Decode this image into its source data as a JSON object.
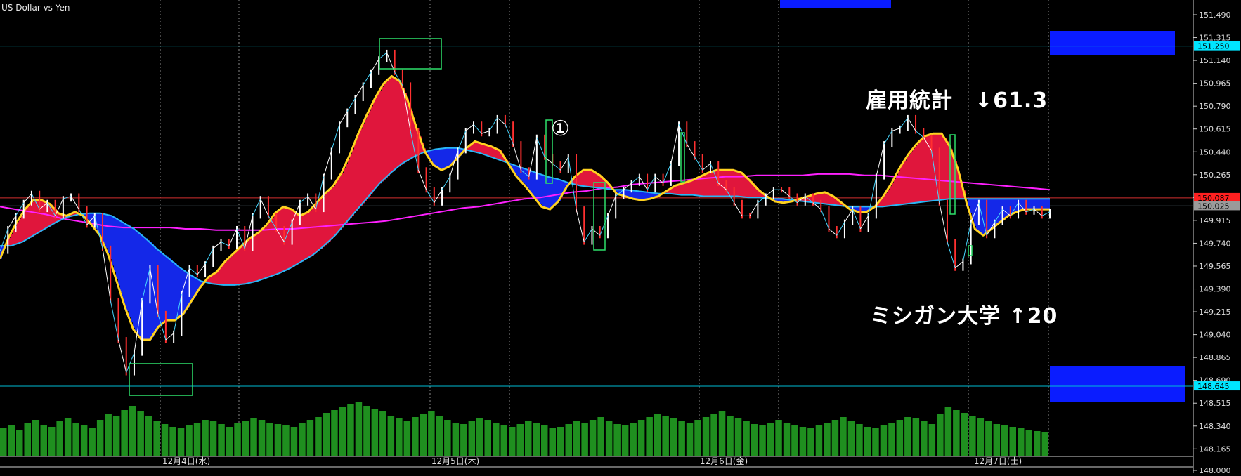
{
  "chart_data": {
    "type": "line",
    "symbol_title": "US Dollar vs Yen",
    "y_ticks": [
      "151.490",
      "151.315",
      "151.140",
      "150.965",
      "150.790",
      "150.615",
      "150.440",
      "150.265",
      "150.090",
      "149.915",
      "149.740",
      "149.565",
      "149.390",
      "149.215",
      "149.040",
      "148.865",
      "148.690",
      "148.515",
      "148.340",
      "148.165",
      "148.000"
    ],
    "y_range": [
      148.0,
      151.49
    ],
    "x_labels": [
      "12月4日(水)",
      "12月5日(木)",
      "12月6日(金)",
      "12月7日(土)"
    ],
    "price_labels": [
      {
        "value": 151.25,
        "text": "151.250",
        "color": "#00e5ff"
      },
      {
        "value": 150.087,
        "text": "150.087",
        "color": "#ff2020"
      },
      {
        "value": 150.025,
        "text": "150.025",
        "color": "#9a9a9a"
      },
      {
        "value": 148.645,
        "text": "148.645",
        "color": "#00e5ff"
      }
    ],
    "horizontal_lines": [
      151.25,
      150.087,
      150.025,
      148.645
    ],
    "series": [
      {
        "color": "#ffffff",
        "values": [
          149.68,
          149.85,
          149.95,
          150.05,
          150.12,
          150.0,
          150.05,
          149.95,
          150.08,
          150.1,
          150.0,
          149.88,
          149.95,
          149.7,
          149.3,
          149.0,
          148.75,
          148.9,
          149.3,
          149.55,
          149.2,
          149.0,
          149.05,
          149.35,
          149.55,
          149.5,
          149.58,
          149.7,
          149.75,
          149.72,
          149.85,
          149.7,
          149.95,
          150.08,
          149.95,
          149.85,
          149.75,
          149.9,
          150.05,
          150.1,
          150.0,
          150.25,
          150.45,
          150.65,
          150.75,
          150.85,
          150.95,
          151.05,
          151.15,
          151.2,
          151.05,
          150.95,
          150.6,
          150.3,
          150.15,
          150.05,
          150.15,
          150.25,
          150.45,
          150.6,
          150.65,
          150.58,
          150.6,
          150.7,
          150.65,
          150.5,
          150.3,
          150.25,
          150.55,
          150.4,
          150.35,
          150.3,
          150.4,
          150.0,
          149.75,
          149.85,
          149.8,
          149.95,
          150.1,
          150.15,
          150.2,
          150.25,
          150.15,
          150.25,
          150.2,
          150.35,
          150.65,
          150.5,
          150.4,
          150.3,
          150.35,
          150.2,
          150.15,
          150.05,
          149.95,
          149.95,
          150.05,
          150.1,
          150.15,
          150.15,
          150.1,
          150.05,
          150.1,
          150.05,
          150.0,
          149.85,
          149.8,
          149.9,
          150.0,
          149.85,
          149.95,
          150.25,
          150.5,
          150.6,
          150.62,
          150.7,
          150.6,
          150.55,
          150.45,
          150.05,
          149.75,
          149.55,
          149.6,
          149.9,
          150.05,
          149.8,
          149.9,
          150.0,
          149.95,
          150.05,
          149.98,
          150.0,
          149.95,
          149.98
        ]
      },
      {
        "color": "#ffd21f",
        "values": [
          149.62,
          149.78,
          149.9,
          150.0,
          150.07,
          150.07,
          150.04,
          149.97,
          149.95,
          149.98,
          149.95,
          149.88,
          149.8,
          149.65,
          149.45,
          149.25,
          149.08,
          149.0,
          149.0,
          149.1,
          149.15,
          149.15,
          149.2,
          149.3,
          149.4,
          149.48,
          149.52,
          149.6,
          149.66,
          149.72,
          149.78,
          149.82,
          149.88,
          149.97,
          150.02,
          150.0,
          149.95,
          149.98,
          150.05,
          150.12,
          150.18,
          150.28,
          150.42,
          150.58,
          150.72,
          150.85,
          150.96,
          151.02,
          150.98,
          150.82,
          150.62,
          150.44,
          150.34,
          150.3,
          150.33,
          150.4,
          150.47,
          150.52,
          150.5,
          150.48,
          150.45,
          150.35,
          150.25,
          150.18,
          150.1,
          150.02,
          150.0,
          150.06,
          150.17,
          150.25,
          150.3,
          150.3,
          150.26,
          150.2,
          150.12,
          150.1,
          150.08,
          150.07,
          150.08,
          150.1,
          150.14,
          150.18,
          150.2,
          150.22,
          150.25,
          150.28,
          150.3,
          150.3,
          150.3,
          150.28,
          150.22,
          150.15,
          150.1,
          150.06,
          150.05,
          150.06,
          150.08,
          150.1,
          150.12,
          150.13,
          150.1,
          150.05,
          150.0,
          149.98,
          149.98,
          150.02,
          150.1,
          150.2,
          150.32,
          150.42,
          150.5,
          150.56,
          150.58,
          150.58,
          150.48,
          150.3,
          150.05,
          149.85,
          149.8,
          149.85,
          149.9,
          149.95,
          149.98,
          150.0,
          150.0,
          150.0,
          150.0
        ]
      },
      {
        "color": "#29b6f6",
        "values": [
          149.72,
          149.72,
          149.75,
          149.8,
          149.85,
          149.9,
          149.94,
          149.96,
          149.97,
          149.97,
          149.95,
          149.9,
          149.85,
          149.78,
          149.7,
          149.63,
          149.56,
          149.5,
          149.45,
          149.43,
          149.42,
          149.42,
          149.43,
          149.45,
          149.48,
          149.51,
          149.55,
          149.6,
          149.65,
          149.72,
          149.8,
          149.9,
          150.0,
          150.1,
          150.2,
          150.28,
          150.35,
          150.4,
          150.44,
          150.46,
          150.47,
          150.47,
          150.45,
          150.43,
          150.4,
          150.37,
          150.34,
          150.31,
          150.28,
          150.25,
          150.23,
          150.2,
          150.18,
          150.17,
          150.16,
          150.15,
          150.15,
          150.14,
          150.13,
          150.12,
          150.12,
          150.11,
          150.11,
          150.1,
          150.1,
          150.1,
          150.1,
          150.09,
          150.09,
          150.08,
          150.08,
          150.07,
          150.06,
          150.05,
          150.04,
          150.03,
          150.02,
          150.02,
          150.02,
          150.02,
          150.03,
          150.04,
          150.05,
          150.06,
          150.07,
          150.08,
          150.08,
          150.08,
          150.08,
          150.08,
          150.08,
          150.08,
          150.08,
          150.08,
          150.08
        ]
      },
      {
        "color": "#ff20ff",
        "values": [
          150.02,
          150.0,
          149.98,
          149.96,
          149.93,
          149.91,
          149.89,
          149.87,
          149.86,
          149.86,
          149.86,
          149.86,
          149.85,
          149.85,
          149.84,
          149.84,
          149.84,
          149.84,
          149.85,
          149.85,
          149.86,
          149.87,
          149.88,
          149.89,
          149.9,
          149.91,
          149.93,
          149.95,
          149.97,
          149.99,
          150.01,
          150.02,
          150.04,
          150.06,
          150.08,
          150.09,
          150.11,
          150.13,
          150.14,
          150.16,
          150.17,
          150.19,
          150.2,
          150.21,
          150.22,
          150.23,
          150.24,
          150.25,
          150.25,
          150.26,
          150.26,
          150.26,
          150.26,
          150.27,
          150.27,
          150.27,
          150.26,
          150.26,
          150.25,
          150.24,
          150.23,
          150.22,
          150.21,
          150.2,
          150.19,
          150.18,
          150.17,
          150.16,
          150.15
        ]
      }
    ],
    "volume": [
      40,
      44,
      38,
      48,
      52,
      45,
      42,
      50,
      55,
      48,
      44,
      40,
      52,
      60,
      58,
      66,
      72,
      64,
      58,
      50,
      46,
      42,
      40,
      44,
      48,
      52,
      50,
      46,
      42,
      48,
      50,
      54,
      52,
      48,
      46,
      44,
      42,
      48,
      52,
      56,
      62,
      66,
      70,
      74,
      78,
      72,
      68,
      64,
      58,
      54,
      50,
      56,
      60,
      64,
      58,
      52,
      48,
      46,
      50,
      54,
      52,
      48,
      44,
      42,
      46,
      50,
      48,
      44,
      40,
      42,
      46,
      50,
      48,
      52,
      56,
      50,
      46,
      44,
      48,
      52,
      56,
      60,
      58,
      54,
      50,
      48,
      52,
      56,
      60,
      64,
      58,
      54,
      50,
      46,
      44,
      48,
      52,
      48,
      44,
      42,
      40,
      44,
      48,
      52,
      56,
      50,
      46,
      42,
      40,
      44,
      48,
      52,
      56,
      54,
      50,
      46,
      60,
      70,
      66,
      62,
      58,
      54,
      50,
      46,
      44,
      42,
      40,
      38,
      36,
      34
    ],
    "annotations": {
      "nfp": "雇用統計　↓61.3",
      "umich": "ミシガン大学 ↑20",
      "circle_one": "①"
    }
  }
}
